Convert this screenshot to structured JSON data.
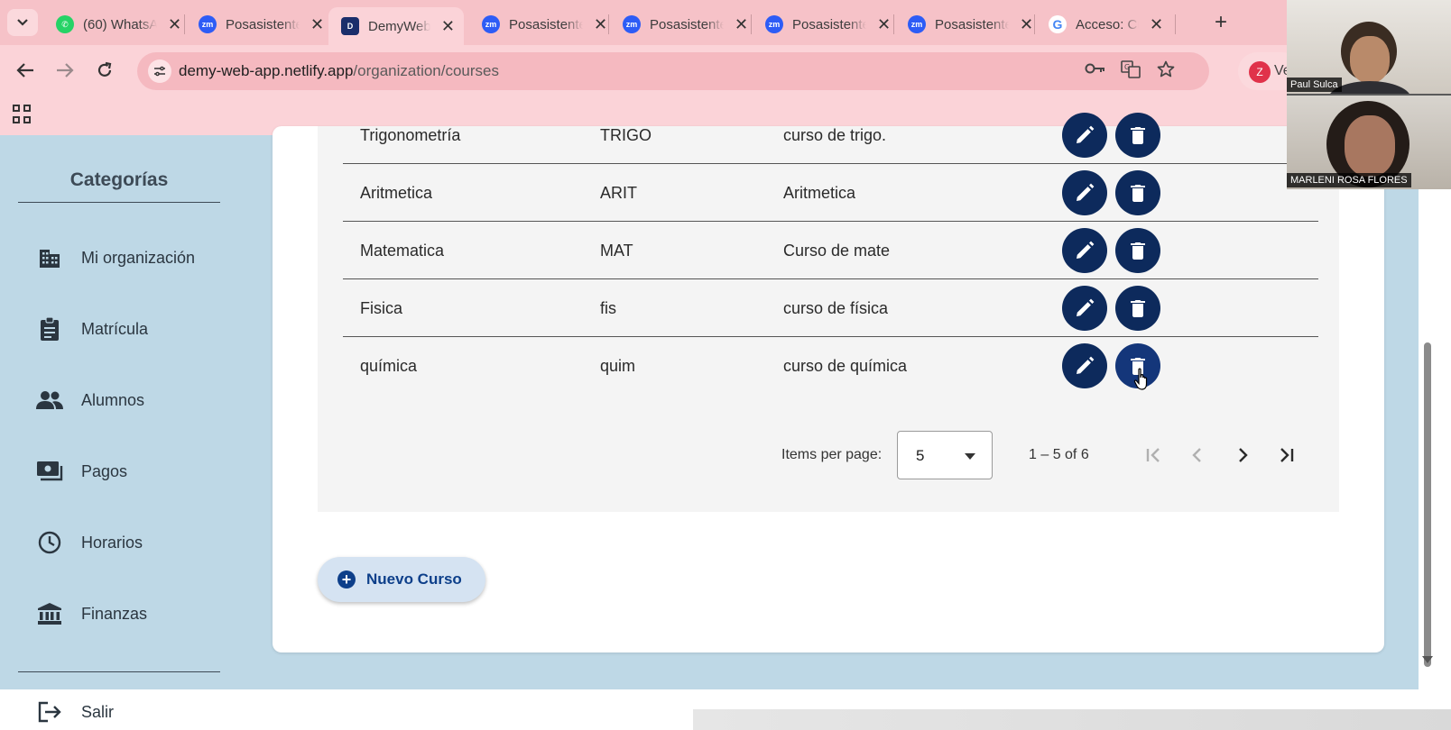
{
  "browser": {
    "tabs": [
      {
        "title": "(60) WhatsApp",
        "favicon": "whatsapp-icon",
        "active": false
      },
      {
        "title": "Posasistente",
        "favicon": "zoom-icon",
        "active": false
      },
      {
        "title": "DemyWeb",
        "favicon": "demy-icon",
        "active": true
      },
      {
        "title": "Posasistente",
        "favicon": "zoom-icon",
        "active": false
      },
      {
        "title": "Posasistente",
        "favicon": "zoom-icon",
        "active": false
      },
      {
        "title": "Posasistente",
        "favicon": "zoom-icon",
        "active": false
      },
      {
        "title": "Posasistente",
        "favicon": "zoom-icon",
        "active": false
      },
      {
        "title": "Acceso: Cu",
        "favicon": "google-icon",
        "active": false
      }
    ],
    "url_host": "demy-web-app.netlify.app",
    "url_path": "/organization/courses",
    "profile_initial": "Z",
    "profile_text": "Ve"
  },
  "sidebar": {
    "title": "Categorías",
    "items": [
      {
        "label": "Mi organización",
        "icon": "building-icon"
      },
      {
        "label": "Matrícula",
        "icon": "clipboard-icon"
      },
      {
        "label": "Alumnos",
        "icon": "people-icon"
      },
      {
        "label": "Pagos",
        "icon": "payments-icon"
      },
      {
        "label": "Horarios",
        "icon": "clock-icon"
      },
      {
        "label": "Finanzas",
        "icon": "bank-icon"
      }
    ],
    "logout_label": "Salir"
  },
  "courses": {
    "rows": [
      {
        "name": "Trigonometría",
        "code": "TRIGO",
        "description": "curso de trigo."
      },
      {
        "name": "Aritmetica",
        "code": "ARIT",
        "description": "Aritmetica"
      },
      {
        "name": "Matematica",
        "code": "MAT",
        "description": "Curso de mate"
      },
      {
        "name": "Fisica",
        "code": "fis",
        "description": "curso de física"
      },
      {
        "name": "química",
        "code": "quim",
        "description": "curso de química"
      }
    ],
    "paginator": {
      "items_per_page_label": "Items per page:",
      "page_size": "5",
      "range_label": "1 – 5 of 6"
    },
    "new_button_label": "Nuevo Curso"
  },
  "video": {
    "participants": [
      {
        "name": "Paul Sulca"
      },
      {
        "name": "MARLENI ROSA FLORES"
      }
    ]
  },
  "colors": {
    "chrome": "#fbd3d8",
    "page_bg": "#bed8e6",
    "action_button": "#0d2a5c",
    "primary_text": "#0d3f8a"
  }
}
